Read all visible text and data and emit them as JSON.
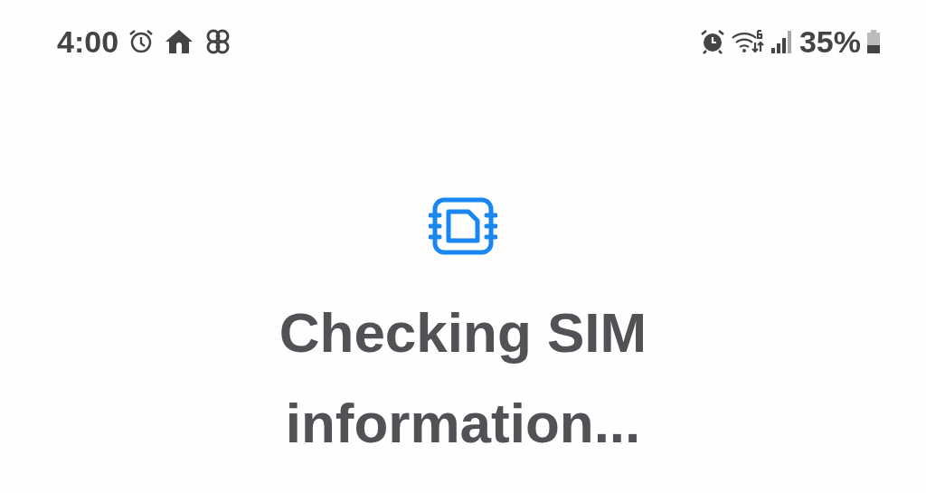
{
  "status_bar": {
    "time": "4:00",
    "battery": "35%"
  },
  "title": "Checking SIM information..."
}
